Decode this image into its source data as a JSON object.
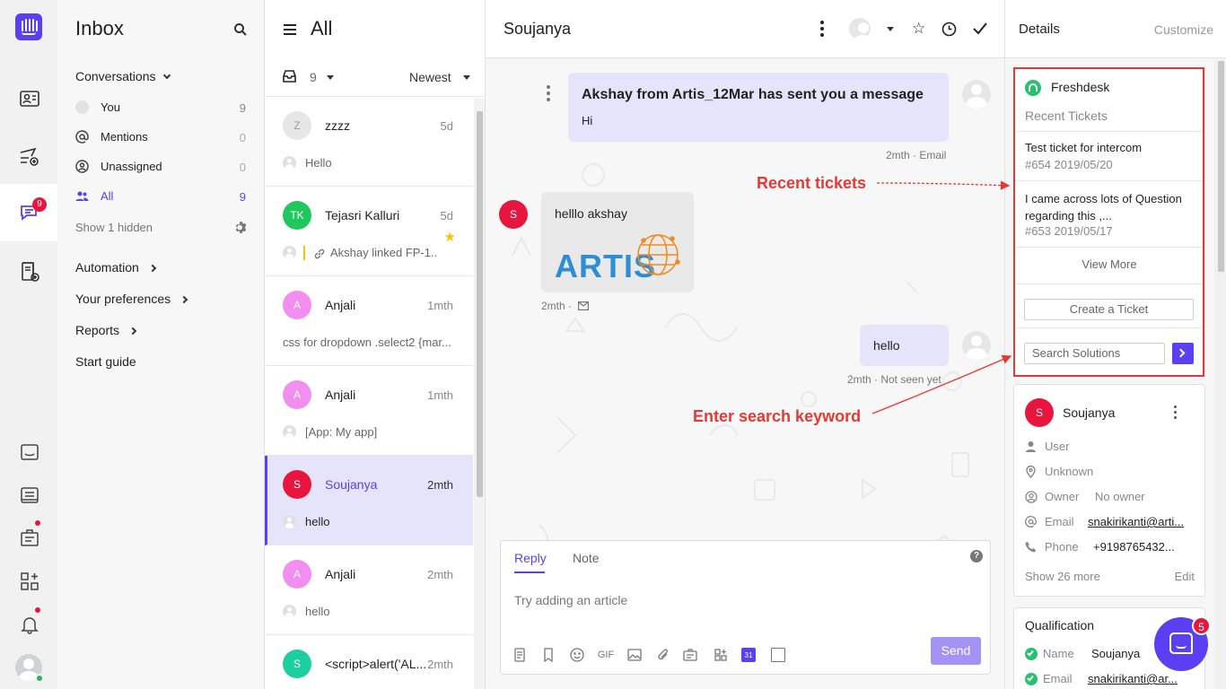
{
  "rail": {
    "badge_count": "9"
  },
  "nav": {
    "title": "Inbox",
    "conversations_label": "Conversations",
    "items": [
      {
        "label": "You",
        "count": "9"
      },
      {
        "label": "Mentions",
        "count": "0"
      },
      {
        "label": "Unassigned",
        "count": "0"
      },
      {
        "label": "All",
        "count": "9"
      }
    ],
    "show_hidden": "Show 1 hidden",
    "sections": [
      {
        "label": "Automation"
      },
      {
        "label": "Your preferences"
      },
      {
        "label": "Reports"
      },
      {
        "label": "Start guide"
      }
    ]
  },
  "list": {
    "title": "All",
    "count": "9",
    "sort": "Newest",
    "conversations": [
      {
        "initials": "Z",
        "name": "zzzz",
        "time": "5d",
        "preview": "Hello",
        "avatar_color": "#e6e6e6"
      },
      {
        "initials": "TK",
        "name": "Tejasri Kalluri",
        "time": "5d",
        "preview": "Akshay linked FP-1...",
        "avatar_color": "#1fc75e"
      },
      {
        "initials": "A",
        "name": "Anjali",
        "time": "1mth",
        "preview": "css for dropdown .select2 {mar...",
        "avatar_color": "#f28ef0"
      },
      {
        "initials": "A",
        "name": "Anjali",
        "time": "1mth",
        "preview": "[App: My app]",
        "avatar_color": "#f28ef0"
      },
      {
        "initials": "S",
        "name": "Soujanya",
        "time": "2mth",
        "preview": "hello",
        "avatar_color": "#e8163f"
      },
      {
        "initials": "A",
        "name": "Anjali",
        "time": "2mth",
        "preview": "hello",
        "avatar_color": "#f28ef0"
      },
      {
        "initials": "S",
        "name": "<script>alert('AL...",
        "time": "2mth",
        "preview": "",
        "avatar_color": "#1ccfa0"
      }
    ]
  },
  "conversation": {
    "title": "Soujanya",
    "messages": [
      {
        "title": "Akshay from Artis_12Mar has sent you a message",
        "body": "Hi",
        "meta": "2mth · Email"
      },
      {
        "avatar": "S",
        "body": "helllo akshay",
        "image_text": "ARTIS",
        "meta": "2mth ·"
      },
      {
        "body": "hello",
        "meta": "2mth · Not seen yet"
      }
    ],
    "composer": {
      "tab_reply": "Reply",
      "tab_note": "Note",
      "placeholder": "Try adding an article",
      "send": "Send",
      "gif": "GIF",
      "calendar_day": "31"
    }
  },
  "details": {
    "title": "Details",
    "customize": "Customize",
    "freshdesk": {
      "name": "Freshdesk",
      "recent_label": "Recent Tickets",
      "tickets": [
        {
          "title": "Test ticket for intercom",
          "meta": "#654 2019/05/20"
        },
        {
          "title": "I came across lots of Question regarding this ,...",
          "meta": "#653 2019/05/17"
        }
      ],
      "view_more": "View More",
      "create": "Create a Ticket",
      "search_placeholder": "Search Solutions"
    },
    "contact": {
      "initial": "S",
      "name": "Soujanya",
      "role": "User",
      "location": "Unknown",
      "owner_label": "Owner",
      "owner_value": "No owner",
      "email_label": "Email",
      "email_value": "snakirikanti@arti...",
      "phone_label": "Phone",
      "phone_value": "+9198765432...",
      "show_more": "Show 26 more",
      "edit": "Edit"
    },
    "qualification": {
      "title": "Qualification",
      "name_label": "Name",
      "name_value": "Soujanya",
      "email_label": "Email",
      "email_value": "snakirikanti@ar..."
    }
  },
  "annotations": {
    "recent_tickets": "Recent tickets",
    "search_keyword": "Enter search keyword"
  },
  "launcher": {
    "badge": "5"
  },
  "colors": {
    "accent": "#5b3ff3",
    "annotation": "#e53935",
    "badge": "#e8163f",
    "freshdesk": "#25c16f"
  }
}
